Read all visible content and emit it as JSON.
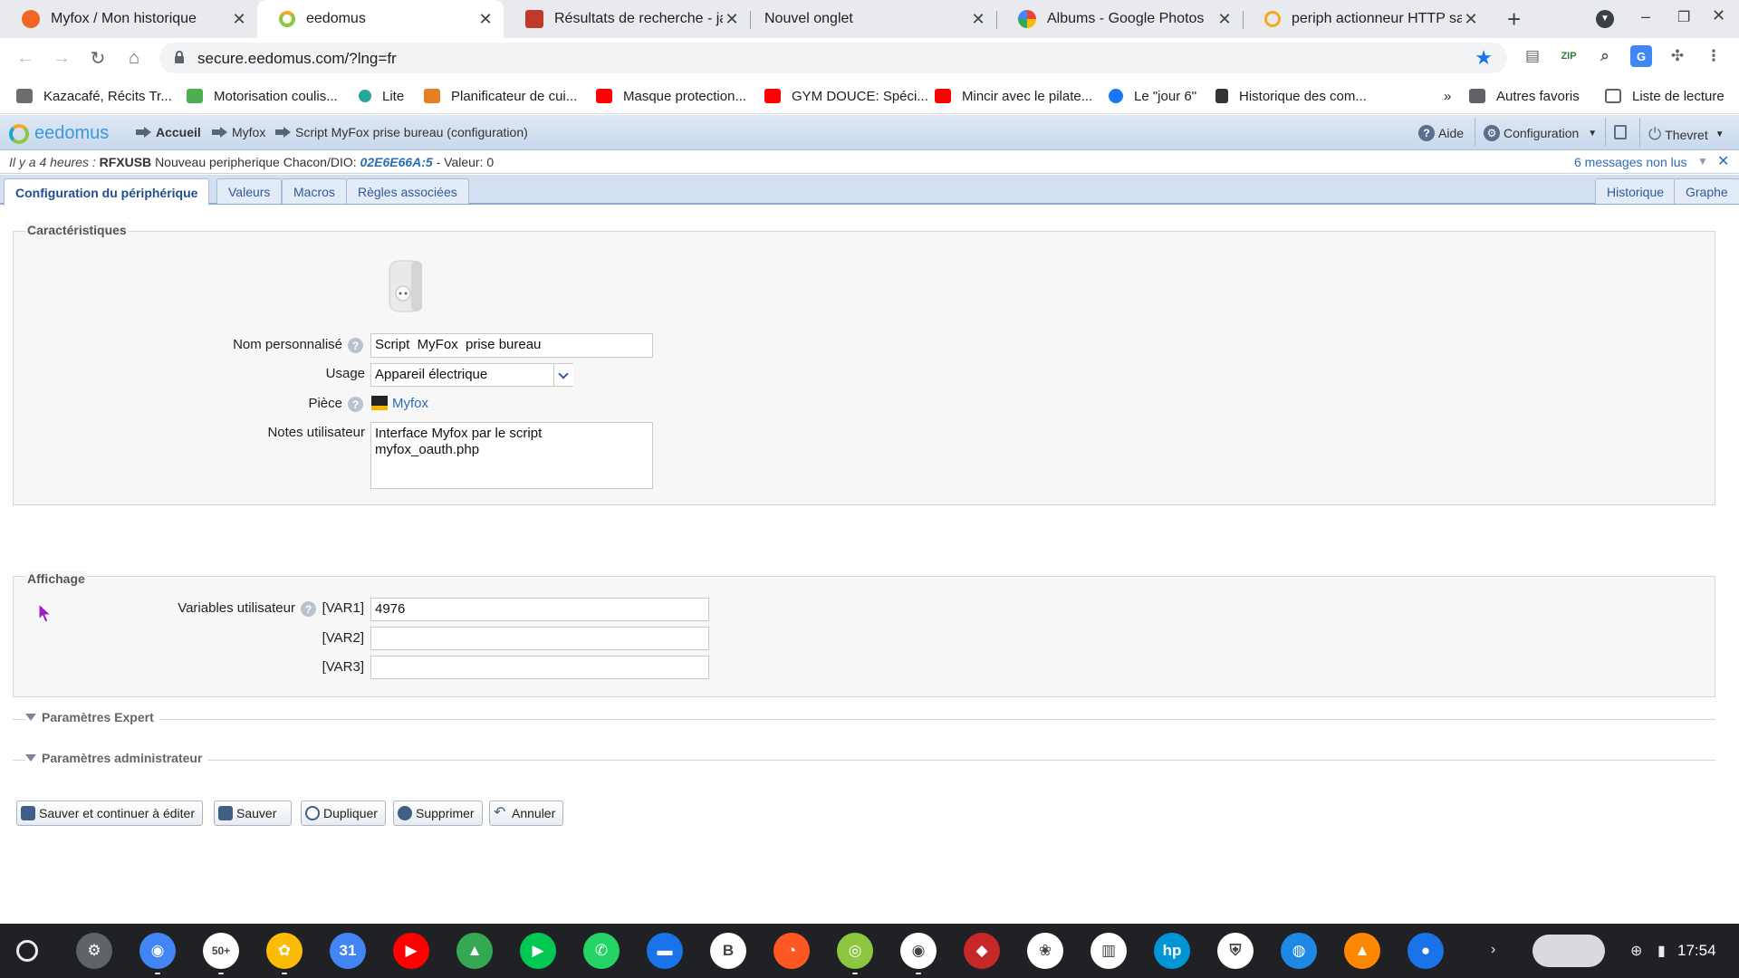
{
  "browser": {
    "tabs": [
      {
        "title": "Myfox / Mon historique",
        "active": false,
        "favicon_color": "#f26522"
      },
      {
        "title": "eedomus",
        "active": true,
        "favicon_color": "#8dc63f"
      },
      {
        "title": "Résultats de recherche - jann",
        "active": false,
        "favicon_color": "#c0392b"
      },
      {
        "title": "Nouvel onglet",
        "active": false,
        "favicon_color": ""
      },
      {
        "title": "Albums - Google Photos",
        "active": false,
        "favicon_color": "#fbbc05"
      },
      {
        "title": "periph actionneur HTTP sans",
        "active": false,
        "favicon_color": "#f5a623"
      }
    ],
    "url": "secure.eedomus.com/?lng=fr",
    "bookmarks": [
      {
        "label": "Kazacafé, Récits Tr...",
        "color": "#6d6d6d"
      },
      {
        "label": "Motorisation coulis...",
        "color": "#4caf50"
      },
      {
        "label": "Lite",
        "color": "#26a69a"
      },
      {
        "label": "Planificateur de cui...",
        "color": "#e67e22"
      },
      {
        "label": "Masque protection...",
        "color": "#ff0000"
      },
      {
        "label": "GYM DOUCE: Spéci...",
        "color": "#ff0000"
      },
      {
        "label": "Mincir avec le pilate...",
        "color": "#ff0000"
      },
      {
        "label": "Le \"jour 6\"",
        "color": "#1877f2"
      },
      {
        "label": "Historique des com...",
        "color": "#333333"
      }
    ],
    "bookmarks_more": "»",
    "other_bookmarks": "Autres favoris",
    "reading_list": "Liste de lecture"
  },
  "app": {
    "logo": "eedomus",
    "breadcrumb": [
      "Accueil",
      "Myfox",
      "Script MyFox prise bureau (configuration)"
    ],
    "help": "Aide",
    "config": "Configuration",
    "user": "Thevret",
    "notification": {
      "time": "Il y a 4 heures :",
      "source": "RFXUSB",
      "text": "Nouveau peripherique Chacon/DIO:",
      "code": "02E6E66A:5",
      "value": "- Valeur: 0",
      "unread": "6 messages non lus"
    },
    "tabs": [
      "Configuration du périphérique",
      "Valeurs",
      "Macros",
      "Règles associées"
    ],
    "tabs_right": [
      "Historique",
      "Graphe"
    ],
    "characteristics": {
      "legend": "Caractéristiques",
      "name_label": "Nom personnalisé",
      "name_value": "Script  MyFox  prise bureau",
      "usage_label": "Usage",
      "usage_value": "Appareil électrique",
      "room_label": "Pièce",
      "room_value": "Myfox",
      "notes_label": "Notes utilisateur",
      "notes_value": "Interface Myfox par le script\nmyfox_oauth.php"
    },
    "display": {
      "legend": "Affichage",
      "vars_label": "Variables utilisateur",
      "vars": [
        {
          "name": "[VAR1]",
          "value": "4976"
        },
        {
          "name": "[VAR2]",
          "value": ""
        },
        {
          "name": "[VAR3]",
          "value": ""
        }
      ]
    },
    "expert": "Paramètres Expert",
    "admin": "Paramètres administrateur",
    "buttons": [
      "Sauver et continuer à éditer",
      "Sauver",
      "Dupliquer",
      "Supprimer",
      "Annuler"
    ]
  },
  "shelf": {
    "time": "17:54",
    "apps": [
      {
        "name": "settings",
        "color": "#5f6368",
        "glyph": "⚙"
      },
      {
        "name": "chrome",
        "color": "#4285f4",
        "glyph": "◉"
      },
      {
        "name": "gmail-50",
        "color": "#ffffff",
        "glyph": "50+"
      },
      {
        "name": "photos",
        "color": "#fbbc05",
        "glyph": "✿"
      },
      {
        "name": "calendar",
        "color": "#4285f4",
        "glyph": "31"
      },
      {
        "name": "youtube",
        "color": "#ff0000",
        "glyph": "▶"
      },
      {
        "name": "drive",
        "color": "#34a853",
        "glyph": "▲"
      },
      {
        "name": "play-store",
        "color": "#00c853",
        "glyph": "▶"
      },
      {
        "name": "whatsapp",
        "color": "#25d366",
        "glyph": "✆"
      },
      {
        "name": "files",
        "color": "#1a73e8",
        "glyph": "▬"
      },
      {
        "name": "b-app",
        "color": "#ffffff",
        "glyph": "B"
      },
      {
        "name": "orange-app",
        "color": "#ff5722",
        "glyph": "◔"
      },
      {
        "name": "eedomus-app",
        "color": "#8dc63f",
        "glyph": "◎"
      },
      {
        "name": "camera-app",
        "color": "#ffffff",
        "glyph": "◉"
      },
      {
        "name": "red-app",
        "color": "#c62828",
        "glyph": "◆"
      },
      {
        "name": "gift-app",
        "color": "#ffffff",
        "glyph": "❀"
      },
      {
        "name": "deezer",
        "color": "#ffffff",
        "glyph": "▥"
      },
      {
        "name": "hp",
        "color": "#0096d6",
        "glyph": "hp"
      },
      {
        "name": "shield-app",
        "color": "#ffffff",
        "glyph": "⛨"
      },
      {
        "name": "bouygues",
        "color": "#1e88e5",
        "glyph": "◍"
      },
      {
        "name": "vlc",
        "color": "#ff8800",
        "glyph": "▲"
      },
      {
        "name": "contacts",
        "color": "#1a73e8",
        "glyph": "●"
      }
    ]
  }
}
